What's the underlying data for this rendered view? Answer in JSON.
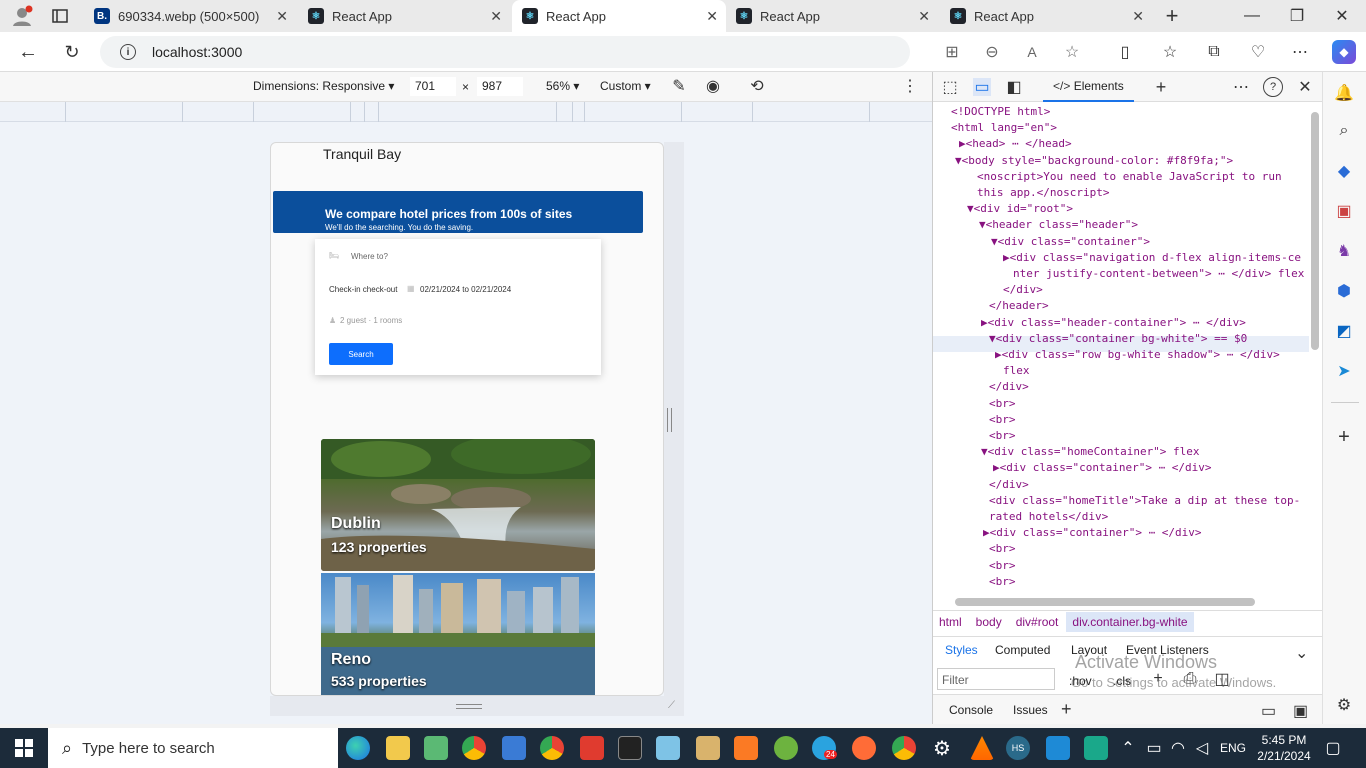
{
  "browser": {
    "tabs": [
      {
        "label": "690334.webp (500×500)",
        "favicon": "B."
      },
      {
        "label": "React App",
        "favicon": "react-icon"
      },
      {
        "label": "React App",
        "favicon": "react-icon",
        "active": true
      },
      {
        "label": "React App",
        "favicon": "react-icon"
      },
      {
        "label": "React App",
        "favicon": "react-icon"
      }
    ],
    "url": "localhost:3000"
  },
  "devtools_toolbar": {
    "dimensions_label": "Dimensions: Responsive",
    "width": "701",
    "x": "×",
    "height": "987",
    "zoom": "56%",
    "throttle": "Custom"
  },
  "app": {
    "brand": "Tranquil Bay",
    "hero_title": "We compare hotel prices from 100s of sites",
    "hero_subtitle": "We'll do the searching. You do the saving.",
    "where_placeholder": "Where to?",
    "checkin_label": "Check-in check-out",
    "dates": "02/21/2024 to 02/21/2024",
    "guests": "2 guest · 1 rooms",
    "search_button": "Search",
    "cards": [
      {
        "city": "Dublin",
        "count": "123 properties"
      },
      {
        "city": "Reno",
        "count": "533 properties"
      }
    ]
  },
  "devtools": {
    "panel_tab": "Elements",
    "dom_lines": [
      "<!DOCTYPE html>",
      "<html lang=\"en\">",
      "▶<head> ⋯ </head>",
      "▼<body style=\"background-color: #f8f9fa;\">",
      "<noscript>You need to enable JavaScript to run",
      "this app.</noscript>",
      "▼<div id=\"root\">",
      "▼<header class=\"header\">",
      "▼<div class=\"container\">",
      "▶<div class=\"navigation d-flex align-items-ce",
      "nter justify-content-between\"> ⋯ </div> flex",
      "</div>",
      "</header>",
      "▶<div class=\"header-container\"> ⋯ </div>",
      "▼<div class=\"container bg-white\"> == $0",
      "▶<div class=\"row bg-white shadow\"> ⋯ </div>",
      "flex",
      "</div>",
      "<br>",
      "<br>",
      "<br>",
      "▼<div class=\"homeContainer\"> flex",
      "▶<div class=\"container\"> ⋯ </div>",
      "</div>",
      "<div class=\"homeTitle\">Take a dip at these top-",
      "rated hotels</div>",
      "▶<div class=\"container\"> ⋯ </div>",
      "<br>",
      "<br>",
      "<br>"
    ],
    "breadcrumbs": [
      "html",
      "body",
      "div#root",
      "div.container.bg-white"
    ],
    "styles_tabs": [
      "Styles",
      "Computed",
      "Layout",
      "Event Listeners"
    ],
    "filter_placeholder": "Filter",
    "hov": ":hov",
    "cls": ".cls",
    "drawer_tabs": [
      "Console",
      "Issues"
    ],
    "watermark_line1": "Activate Windows",
    "watermark_line2": "Go to Settings to activate Windows."
  },
  "taskbar": {
    "search_placeholder": "Type here to search",
    "lang": "ENG",
    "time": "5:45 PM",
    "date": "2/21/2024",
    "telegram_badge": "24"
  }
}
